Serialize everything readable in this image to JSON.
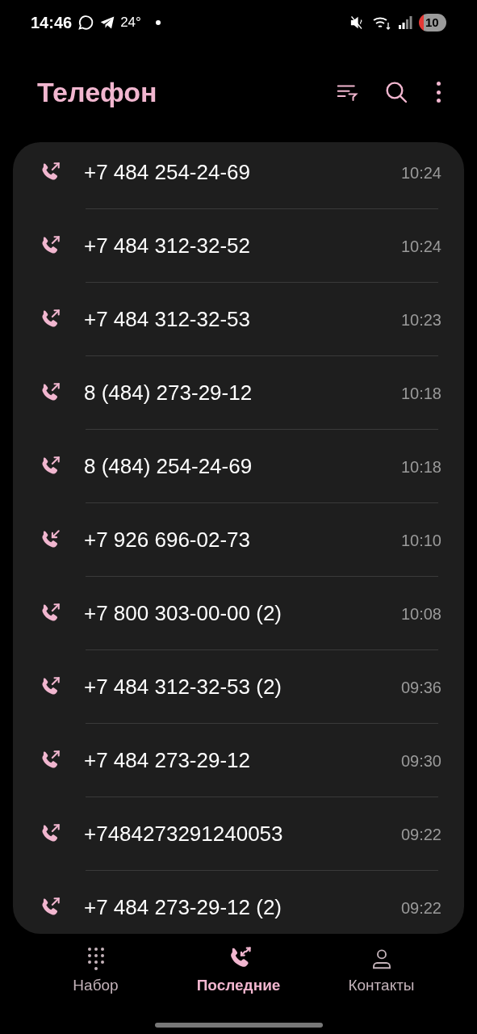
{
  "status_bar": {
    "time": "14:46",
    "temperature": "24°",
    "battery": "10"
  },
  "header": {
    "title": "Телефон"
  },
  "calls": [
    {
      "number": "+7 484 254-24-69",
      "time": "10:24",
      "kind": "outgoing"
    },
    {
      "number": "+7 484 312-32-52",
      "time": "10:24",
      "kind": "outgoing"
    },
    {
      "number": "+7 484 312-32-53",
      "time": "10:23",
      "kind": "outgoing"
    },
    {
      "number": "8 (484) 273-29-12",
      "time": "10:18",
      "kind": "outgoing"
    },
    {
      "number": "8 (484) 254-24-69",
      "time": "10:18",
      "kind": "outgoing"
    },
    {
      "number": "+7 926 696-02-73",
      "time": "10:10",
      "kind": "incoming"
    },
    {
      "number": "+7 800 303-00-00 (2)",
      "time": "10:08",
      "kind": "outgoing"
    },
    {
      "number": "+7 484 312-32-53 (2)",
      "time": "09:36",
      "kind": "outgoing"
    },
    {
      "number": "+7 484 273-29-12",
      "time": "09:30",
      "kind": "outgoing"
    },
    {
      "number": "+7484273291240053",
      "time": "09:22",
      "kind": "outgoing"
    },
    {
      "number": "+7 484 273-29-12 (2)",
      "time": "09:22",
      "kind": "outgoing"
    }
  ],
  "bottom_nav": [
    {
      "label": "Набор",
      "kind": "keypad",
      "selected": false
    },
    {
      "label": "Последние",
      "kind": "recents",
      "selected": true
    },
    {
      "label": "Контакты",
      "kind": "contacts",
      "selected": false
    }
  ]
}
